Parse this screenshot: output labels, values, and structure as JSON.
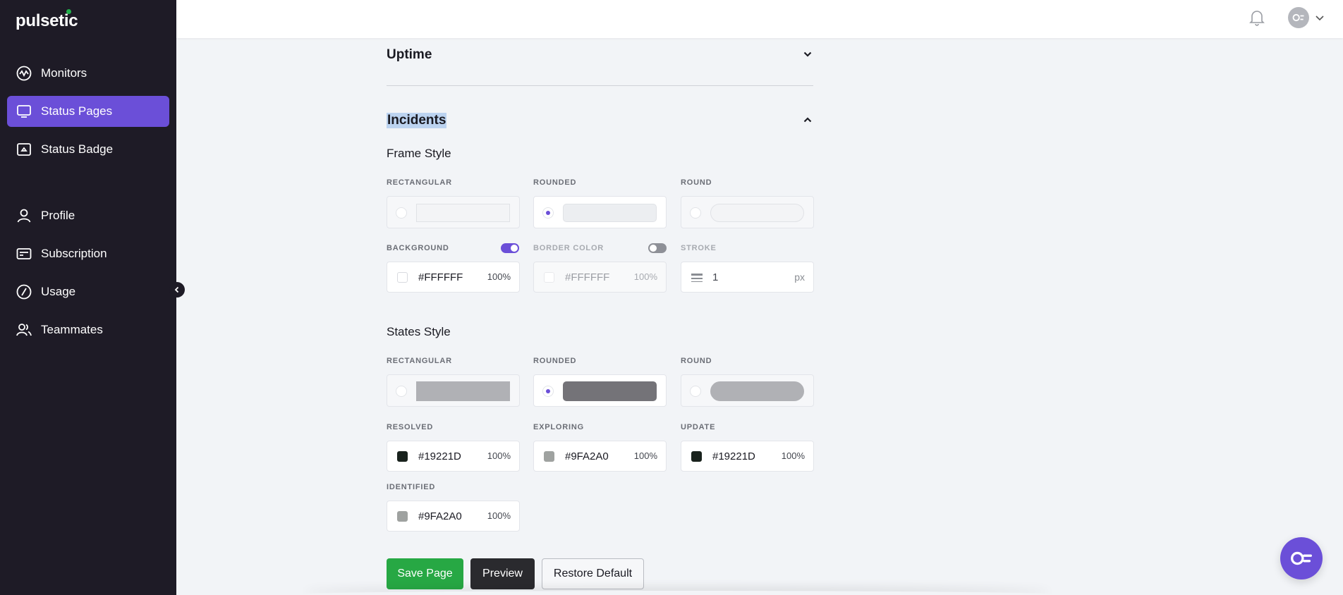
{
  "app": {
    "logo": "pulsetic"
  },
  "sidebar": {
    "items": [
      {
        "label": "Monitors",
        "icon": "monitor-pulse-icon"
      },
      {
        "label": "Status Pages",
        "icon": "status-page-icon",
        "active": true
      },
      {
        "label": "Status Badge",
        "icon": "status-badge-icon"
      },
      {
        "label": "Profile",
        "icon": "user-icon"
      },
      {
        "label": "Subscription",
        "icon": "card-icon"
      },
      {
        "label": "Usage",
        "icon": "gauge-icon"
      },
      {
        "label": "Teammates",
        "icon": "users-icon"
      }
    ],
    "active_color": "#6B4FD8",
    "bg_color": "#1E1B26"
  },
  "sections": {
    "uptime": {
      "title": "Uptime",
      "state": "collapsed"
    },
    "incidents": {
      "title": "Incidents",
      "state": "expanded"
    }
  },
  "frame_style": {
    "title": "Frame Style",
    "options": [
      {
        "label": "RECTANGULAR",
        "selected": false,
        "disabled": true
      },
      {
        "label": "ROUNDED",
        "selected": true,
        "disabled": false
      },
      {
        "label": "ROUND",
        "selected": false,
        "disabled": true
      }
    ],
    "background": {
      "label": "BACKGROUND",
      "enabled": true,
      "hex": "#FFFFFF",
      "opacity": "100%"
    },
    "border_color": {
      "label": "BORDER COLOR",
      "enabled": false,
      "hex": "#FFFFFF",
      "opacity": "100%"
    },
    "stroke": {
      "label": "STROKE",
      "value": "1",
      "unit": "px"
    }
  },
  "states_style": {
    "title": "States Style",
    "options": [
      {
        "label": "RECTANGULAR",
        "selected": false
      },
      {
        "label": "ROUNDED",
        "selected": true
      },
      {
        "label": "ROUND",
        "selected": false
      }
    ],
    "colors": {
      "resolved": {
        "label": "RESOLVED",
        "hex": "#19221D",
        "opacity": "100%"
      },
      "exploring": {
        "label": "EXPLORING",
        "hex": "#9FA2A0",
        "opacity": "100%"
      },
      "update": {
        "label": "UPDATE",
        "hex": "#19221D",
        "opacity": "100%"
      },
      "identified": {
        "label": "IDENTIFIED",
        "hex": "#9FA2A0",
        "opacity": "100%"
      }
    }
  },
  "actions": {
    "save": "Save Page",
    "preview": "Preview",
    "restore": "Restore Default",
    "save_color": "#27A844",
    "preview_color": "#2A2A2E"
  }
}
